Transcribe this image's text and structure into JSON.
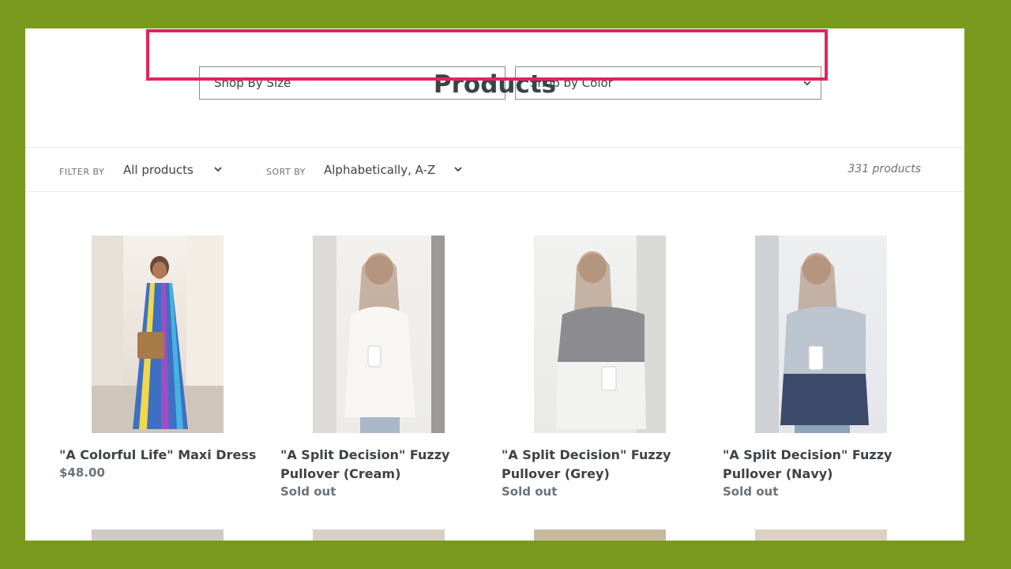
{
  "header": {
    "shop_by_size": "Shop By Size",
    "shop_by_color": "Shop by Color",
    "title": "Products"
  },
  "filters": {
    "filter_label": "FILTER BY",
    "filter_value": "All products",
    "sort_label": "SORT BY",
    "sort_value": "Alphabetically, A-Z",
    "count": "331 products"
  },
  "products": [
    {
      "name": "\"A Colorful Life\" Maxi Dress",
      "status": "$48.00"
    },
    {
      "name": "\"A Split Decision\" Fuzzy Pullover (Cream)",
      "status": "Sold out"
    },
    {
      "name": "\"A Split Decision\" Fuzzy Pullover (Grey)",
      "status": "Sold out"
    },
    {
      "name": "\"A Split Decision\" Fuzzy Pullover (Navy)",
      "status": "Sold out"
    }
  ],
  "colors": {
    "background": "#7a9a1d",
    "highlight": "#e0245e",
    "text": "#3d4246",
    "muted": "#69727b"
  }
}
